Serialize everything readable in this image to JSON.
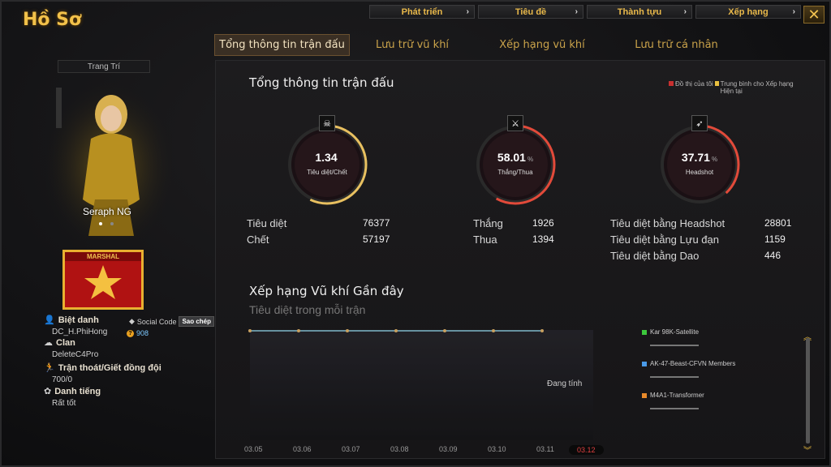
{
  "window": {
    "title": "Hồ Sơ"
  },
  "topnav": [
    {
      "label": "Phát triển"
    },
    {
      "label": "Tiêu đề"
    },
    {
      "label": "Thành tựu"
    },
    {
      "label": "Xếp hạng"
    }
  ],
  "tabs": [
    {
      "label": "Tổng thông tin trận đấu",
      "active": true
    },
    {
      "label": "Lưu trữ vũ khí"
    },
    {
      "label": "Xếp hạng vũ khí"
    },
    {
      "label": "Lưu trữ cá nhân"
    }
  ],
  "profile": {
    "decor_label": "Trang Trí",
    "character_name": "Seraph NG",
    "rank_label": "MARSHAL",
    "social_code_label": "Social Code",
    "copy_label": "Sao chép",
    "coin_value": "908",
    "nickname_label": "Biệt danh",
    "nickname_value": "DC_H.PhiHong",
    "clan_label": "Clan",
    "clan_value": "DeleteC4Pro",
    "escape_label": "Trận thoát/Giết đồng đội",
    "escape_value": "700/0",
    "reputation_label": "Danh tiếng",
    "reputation_value": "Rất tốt"
  },
  "summary": {
    "title": "Tổng thông tin trận đấu",
    "legend_mine": "Đồ thị của tôi",
    "legend_avg": "Trung bình cho Xếp hạng Hiện tại",
    "circles": [
      {
        "value": "1.34",
        "pct": "",
        "label": "Tiêu diệt/Chết",
        "icon": "skull-icon",
        "fraction": 0.57
      },
      {
        "value": "58.01",
        "pct": "%",
        "label": "Thắng/Thua",
        "icon": "crossed-swords-icon",
        "fraction": 0.58
      },
      {
        "value": "37.71",
        "pct": "%",
        "label": "Headshot",
        "icon": "sniper-icon",
        "fraction": 0.38
      }
    ],
    "stats": {
      "kills_label": "Tiêu diệt",
      "kills": "76377",
      "deaths_label": "Chết",
      "deaths": "57197",
      "wins_label": "Thắng",
      "wins": "1926",
      "losses_label": "Thua",
      "losses": "1394",
      "headshot_label": "Tiêu diệt bằng Headshot",
      "headshot": "28801",
      "grenade_label": "Tiêu diệt bằng Lựu đạn",
      "grenade": "1159",
      "knife_label": "Tiêu diệt bằng Dao",
      "knife": "446"
    }
  },
  "weapon_rank": {
    "title": "Xếp hạng Vũ khí Gần đây",
    "subtitle": "Tiêu diệt trong mỗi trận",
    "status": "Đang tính",
    "dates": [
      "03.05",
      "03.06",
      "03.07",
      "03.08",
      "03.09",
      "03.10",
      "03.11",
      "03.12"
    ],
    "weapons": [
      {
        "name": "Kar 98K-Satellite",
        "color": "#3cc83c"
      },
      {
        "name": "AK-47-Beast-CFVN Members",
        "color": "#4a9ae8"
      },
      {
        "name": "M4A1-Transformer",
        "color": "#e88a2a"
      }
    ]
  },
  "colors": {
    "accent": "#f2c14a",
    "ring_red": "#e24a3a",
    "ring_gold": "#e8c060"
  }
}
